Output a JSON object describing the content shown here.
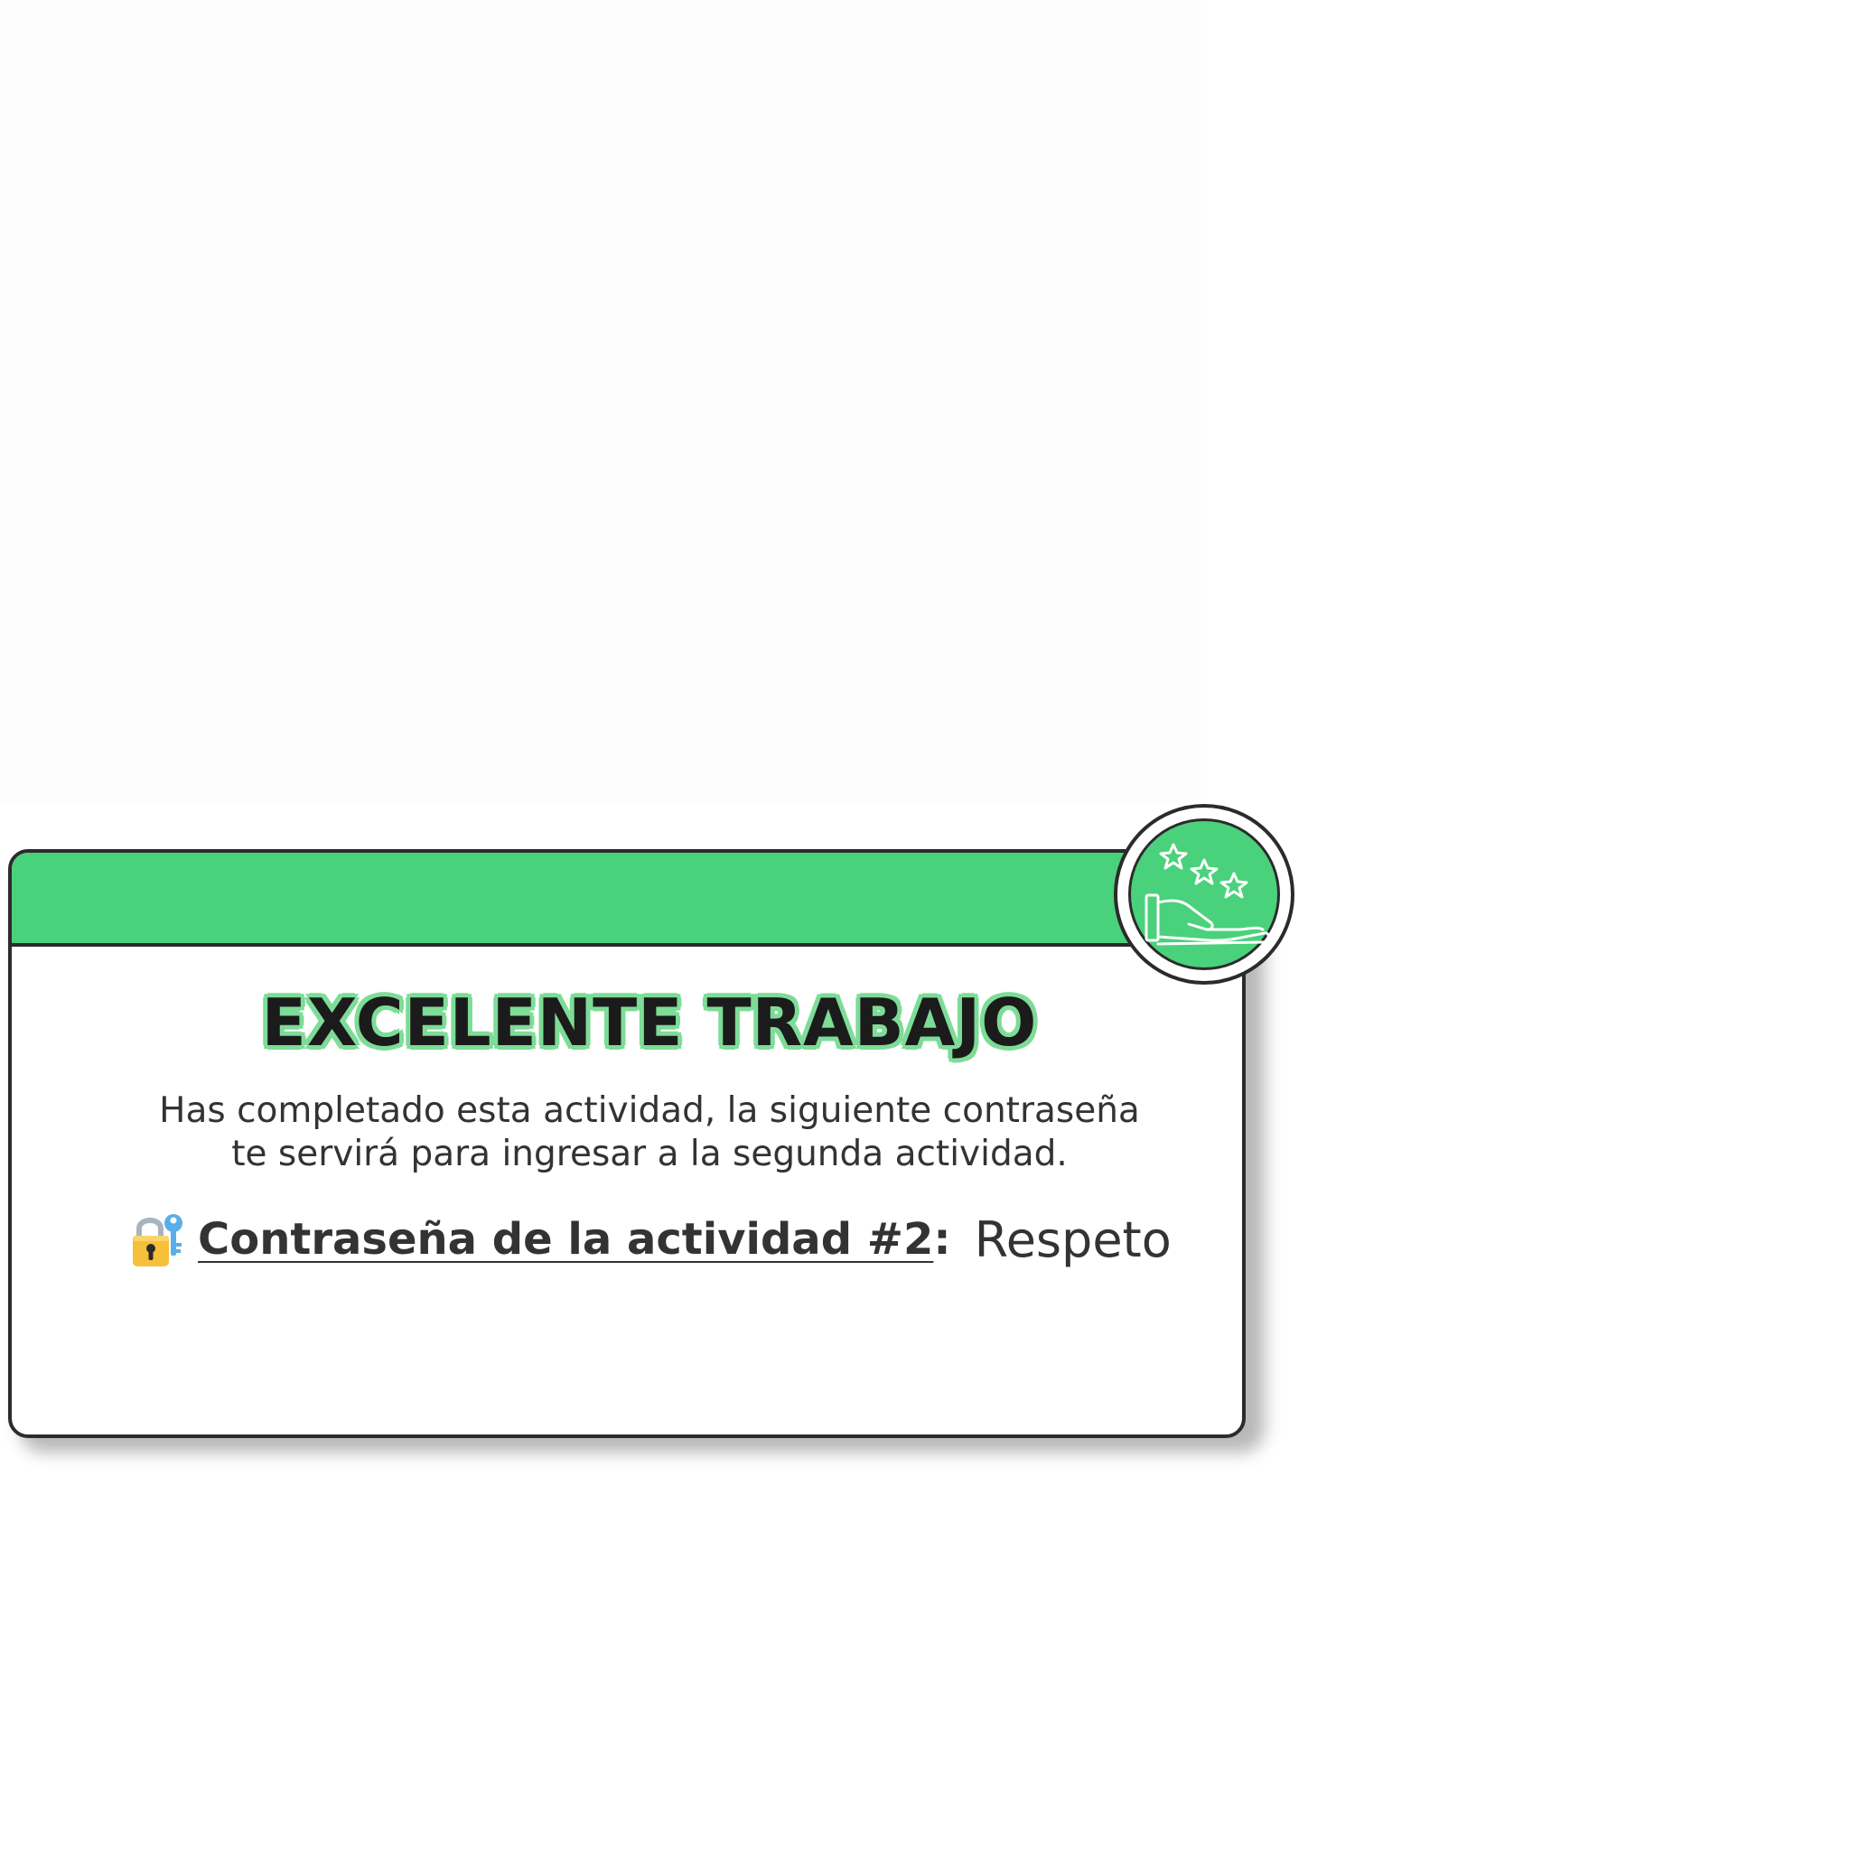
{
  "card": {
    "title": "EXCELENTE TRABAJO",
    "message_line_1": "Has completado esta actividad, la siguiente contraseña",
    "message_line_2": "te servirá para ingresar a la segunda actividad.",
    "password_label": "Contraseña de la actividad #2",
    "password_colon": ":",
    "password_value": "Respeto"
  },
  "icons": {
    "badge": "hand-with-stars-icon",
    "password": "locked-with-key-icon"
  },
  "colors": {
    "header_green": "#4ad17b",
    "title_glow": "#7ddc97",
    "text": "#333333",
    "border": "#2b2b2b"
  }
}
